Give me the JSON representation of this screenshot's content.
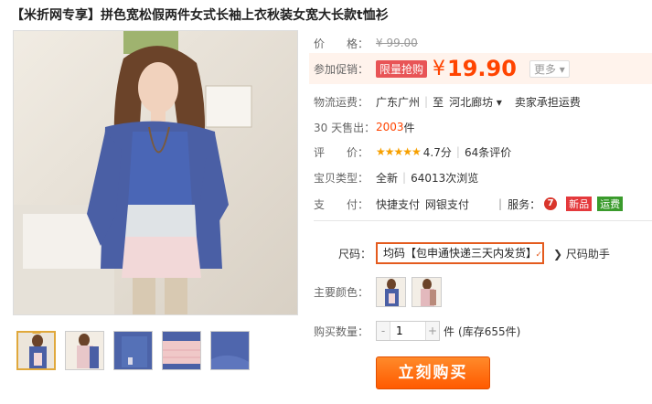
{
  "product": {
    "title": "【米折网专享】拼色宽松假两件女式长袖上衣秋装女宽大长款t恤衫"
  },
  "price": {
    "label": "价　　格：",
    "original": "¥ 99.00"
  },
  "promo": {
    "label": "参加促销：",
    "tag": "限量抢购",
    "currency": "¥",
    "value": "19.90",
    "more": "更多 ▾"
  },
  "shipping": {
    "label": "物流运费：",
    "from": "广东广州",
    "to_prefix": "至",
    "to": "河北廊坊 ▾",
    "fee": "卖家承担运费"
  },
  "sales": {
    "label": "30 天售出：",
    "count": "2003",
    "unit": "件"
  },
  "rating": {
    "label": "评　　价：",
    "stars": "★★★★★",
    "score": "4.7分",
    "reviews": "64条评价"
  },
  "item_type": {
    "label": "宝贝类型：",
    "condition": "全新",
    "views": "64013次浏览"
  },
  "payment": {
    "label": "支　　付：",
    "methods": [
      "快捷支付",
      "网银支付"
    ],
    "service_label": "服务：",
    "service_icon": "7",
    "badges": [
      "新品",
      "运费"
    ]
  },
  "size": {
    "label": "尺码：",
    "selected": "均码【包申通快递三天内发货】",
    "helper": "尺码助手"
  },
  "color": {
    "label": "主要颜色："
  },
  "quantity": {
    "label": "购买数量：",
    "minus": "-",
    "value": "1",
    "plus": "+",
    "unit": "件",
    "stock": "(库存655件)"
  },
  "buy_button": "立刻购买",
  "colors": {
    "accent": "#ff4400",
    "cardigan": "#4a5fa5",
    "button_top": "#ff8a2a",
    "button_bottom": "#ff5a00"
  }
}
